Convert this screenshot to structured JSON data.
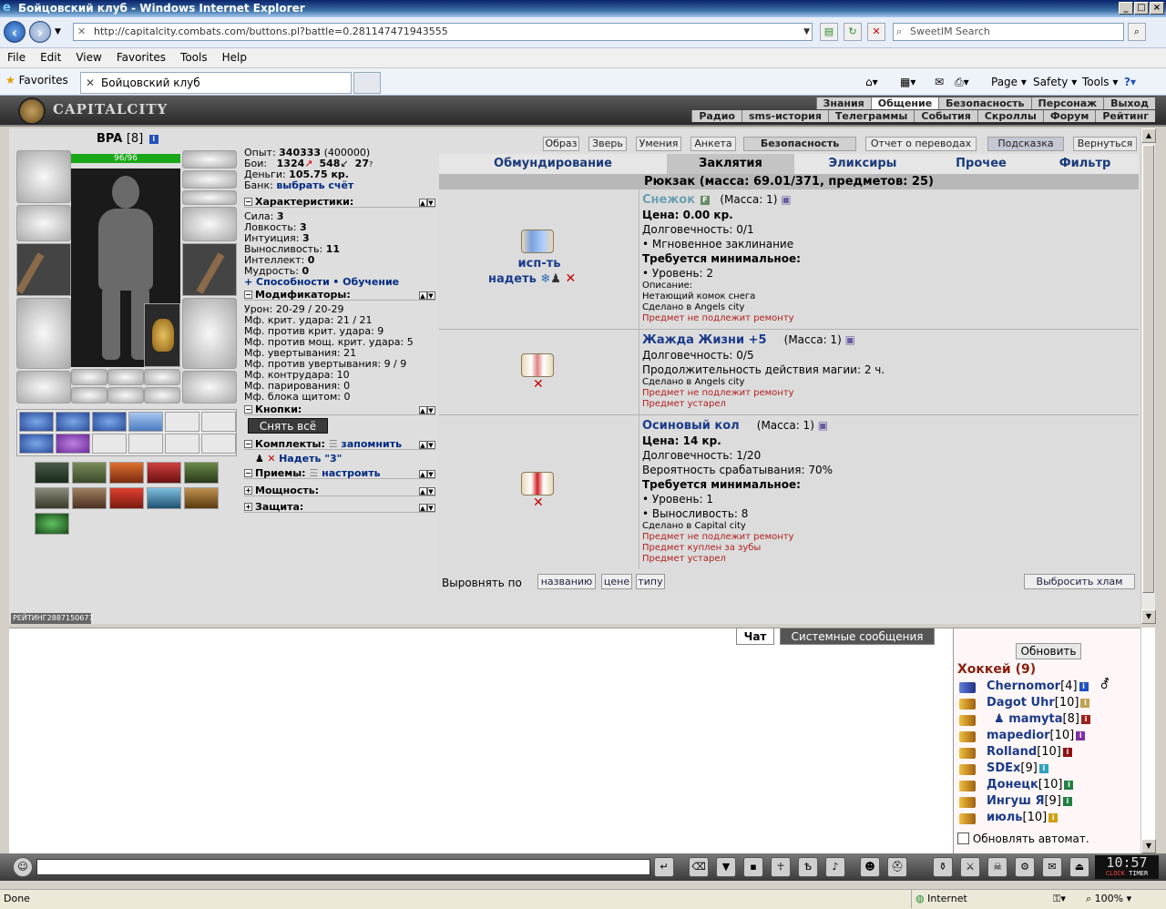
{
  "window": {
    "title": "Бойцовский клуб - Windows Internet Explorer"
  },
  "browser": {
    "url": "http://capitalcity.combats.com/buttons.pl?battle=0.281147471943555",
    "search_placeholder": "SweetIM Search",
    "menu": [
      "File",
      "Edit",
      "View",
      "Favorites",
      "Tools",
      "Help"
    ],
    "favorites_label": "Favorites",
    "tab_title": "Бойцовский клуб",
    "commands": {
      "page": "Page",
      "safety": "Safety",
      "tools": "Tools"
    },
    "status_left": "Done",
    "status_zone": "Internet",
    "zoom": "100%"
  },
  "game": {
    "logo": "CAPITALCITY",
    "topnav_row1": [
      "Знания",
      "Общение",
      "Безопасность",
      "Персонаж",
      "Выход"
    ],
    "topnav_row2": [
      "Радио",
      "sms-история",
      "Телеграммы",
      "События",
      "Скроллы",
      "Форум",
      "Рейтинг"
    ],
    "character": {
      "name": "BPA",
      "level": "[8]",
      "hp": "96/96",
      "rating_label": "РЕЙТИНГ",
      "rating_value": "2887150677"
    },
    "stats": {
      "exp_label": "Опыт:",
      "exp_value": "340333",
      "exp_next": "(400000)",
      "battles_label": "Бои:",
      "wins": "1324",
      "losses": "548",
      "draws": "27",
      "money_label": "Деньги:",
      "money_value": "105.75 кр.",
      "bank_label": "Банк:",
      "bank_link": "выбрать счёт"
    },
    "characteristics": {
      "title": "Характеристики:",
      "rows": [
        {
          "label": "Сила:",
          "value": "3"
        },
        {
          "label": "Ловкость:",
          "value": "3"
        },
        {
          "label": "Интуиция:",
          "value": "3"
        },
        {
          "label": "Выносливость:",
          "value": "11"
        },
        {
          "label": "Интеллект:",
          "value": "0"
        },
        {
          "label": "Мудрость:",
          "value": "0"
        }
      ],
      "abilities_link": "+ Способности",
      "training_link": "• Обучение"
    },
    "modifiers": {
      "title": "Модификаторы:",
      "rows": [
        {
          "label": "Урон:",
          "value": "20-29 / 20-29"
        },
        {
          "label": "Мф. крит. удара:",
          "value": "21 / 21"
        },
        {
          "label": "Мф. против крит. удара:",
          "value": "9"
        },
        {
          "label": "Мф. против мощ. крит. удара:",
          "value": "5"
        },
        {
          "label": "Мф. увертывания:",
          "value": "21"
        },
        {
          "label": "Мф. против увертывания:",
          "value": "9 / 9"
        },
        {
          "label": "Мф. контрудара:",
          "value": "10"
        },
        {
          "label": "Мф. парирования:",
          "value": "0"
        },
        {
          "label": "Мф. блока щитом:",
          "value": "0"
        }
      ]
    },
    "sections": {
      "buttons": "Кнопки:",
      "undress_all": "Снять всё",
      "sets": "Комплекты:",
      "sets_link": "запомнить",
      "set_item": "Надеть \"3\"",
      "tricks": "Приемы:",
      "tricks_link": "настроить",
      "powers": "Мощность:",
      "defense": "Защита:"
    },
    "top_buttons": [
      "Образ",
      "Зверь",
      "Умения",
      "Анкета",
      "Безопасность",
      "Отчет о переводах",
      "Подсказка",
      "Вернуться"
    ],
    "tabs": [
      "Обмундирование",
      "Заклятия",
      "Эликсиры",
      "Прочее",
      "Фильтр"
    ],
    "active_tab": "Заклятия",
    "backpack": "Рюкзак (масса: 69.01/371, предметов: 25)",
    "items": [
      {
        "name": "Снежок",
        "mass": "(Масса: 1)",
        "use_label": "исп-ть",
        "wear_label": "надеть",
        "lines_bold": [
          "Цена: 0.00 кр."
        ],
        "durability": "Долговечность: 0/1",
        "bullet1": "• Мгновенное заклинание",
        "req_title": "Требуется минимальное:",
        "req1": "• Уровень: 2",
        "desc_label": "Описание:",
        "desc": "Нетающий комок снега",
        "made": "Сделано в Angels city",
        "red1": "Предмет не подлежит ремонту"
      },
      {
        "name": "Жажда Жизни +5",
        "mass": "(Масса: 1)",
        "durability": "Долговечность: 0/5",
        "duration": "Продолжительность действия магии: 2 ч.",
        "made": "Сделано в Angels city",
        "red1": "Предмет не подлежит ремонту",
        "red2": "Предмет устарел"
      },
      {
        "name": "Осиновый кол",
        "mass": "(Масса: 1)",
        "price": "Цена: 14 кр.",
        "durability": "Долговечность: 1/20",
        "chance": "Вероятность срабатывания: 70%",
        "req_title": "Требуется минимальное:",
        "req1": "• Уровень: 1",
        "req2": "• Выносливость: 8",
        "made": "Сделано в Capital city",
        "red1": "Предмет не подлежит ремонту",
        "red2": "Предмет куплен за зубы",
        "red3": "Предмет устарел"
      }
    ],
    "sort": {
      "label": "Выровнять по",
      "by_name": "названию",
      "by_price": "цене",
      "by_type": "типу",
      "drop_junk": "Выбросить хлам"
    }
  },
  "chat": {
    "tabs": [
      "Чат",
      "Системные сообщения"
    ],
    "refresh": "Обновить",
    "room": "Хоккей (9)",
    "users": [
      {
        "name": "Chernomor",
        "level": "[4]",
        "badge": "#2050c0"
      },
      {
        "name": "Dagot Uhr",
        "level": "[10]",
        "badge": "#c0a050"
      },
      {
        "name": "mamyta",
        "level": "[8]",
        "badge": "#a02020"
      },
      {
        "name": "mapedior",
        "level": "[10]",
        "badge": "#8030a0"
      },
      {
        "name": "Rolland",
        "level": "[10]",
        "badge": "#901010"
      },
      {
        "name": "SDEx",
        "level": "[9]",
        "badge": "#30a0c0"
      },
      {
        "name": "Донецк",
        "level": "[10]",
        "badge": "#208040"
      },
      {
        "name": "Ингуш Я",
        "level": "[9]",
        "badge": "#208040"
      },
      {
        "name": "июль",
        "level": "[10]",
        "badge": "#d0a010"
      }
    ],
    "auto_refresh": "Обновлять автомат."
  },
  "clock": {
    "time": "10:57",
    "clock_label": "CLOCK",
    "timer_label": "TIMER"
  }
}
